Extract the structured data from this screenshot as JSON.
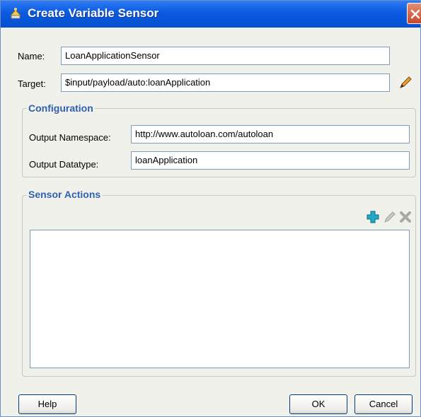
{
  "window": {
    "title": "Create Variable Sensor"
  },
  "icons": {
    "title": "gear-sensor-icon",
    "close": "close-icon",
    "target_edit": "pencil-icon",
    "add": "add-plus-icon",
    "edit": "edit-pencil-icon",
    "delete": "delete-x-icon"
  },
  "form": {
    "name_label": "Name:",
    "name_value": "LoanApplicationSensor",
    "target_label": "Target:",
    "target_value": "$input/payload/auto:loanApplication"
  },
  "configuration": {
    "legend": "Configuration",
    "namespace_label": "Output Namespace:",
    "namespace_value": "http://www.autoloan.com/autoloan",
    "datatype_label": "Output Datatype:",
    "datatype_value": "loanApplication"
  },
  "sensor_actions": {
    "legend": "Sensor Actions",
    "items": []
  },
  "buttons": {
    "help": "Help",
    "ok": "OK",
    "cancel": "Cancel"
  },
  "colors": {
    "titlebar": "#0a5ae0",
    "legend": "#2f5fb0",
    "add_icon": "#22a8c8",
    "dialog_bg": "#f1f1ec"
  }
}
